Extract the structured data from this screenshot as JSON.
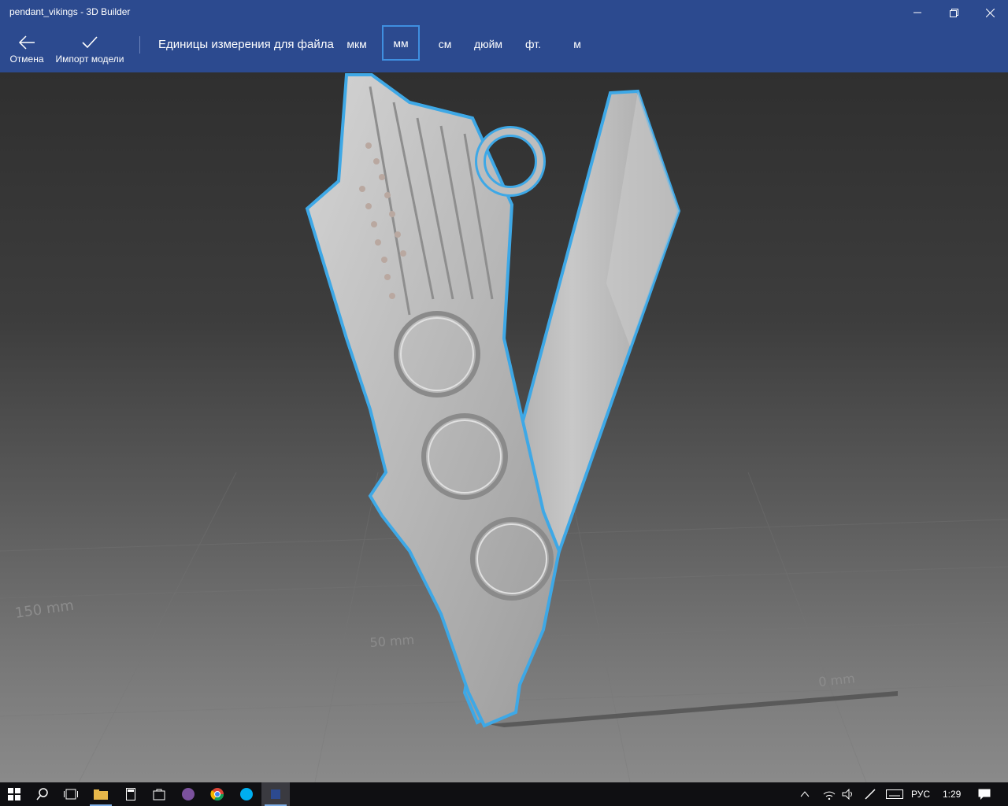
{
  "window": {
    "title": "pendant_vikings - 3D Builder"
  },
  "toolbar": {
    "cancel_label": "Отмена",
    "import_label": "Импорт модели",
    "units_caption": "Единицы измерения для файла",
    "units": [
      "мкм",
      "мм",
      "см",
      "дюйм",
      "фт.",
      "м"
    ],
    "selected_unit": "мм"
  },
  "viewport": {
    "grid_labels": [
      "150 mm",
      "50 mm",
      "0 mm"
    ],
    "highlight_color": "#3ea8e6"
  },
  "taskbar": {
    "language": "РУС",
    "time": "1:29"
  },
  "colors": {
    "accent": "#2c4a8f",
    "selection": "#3ea8e6"
  }
}
